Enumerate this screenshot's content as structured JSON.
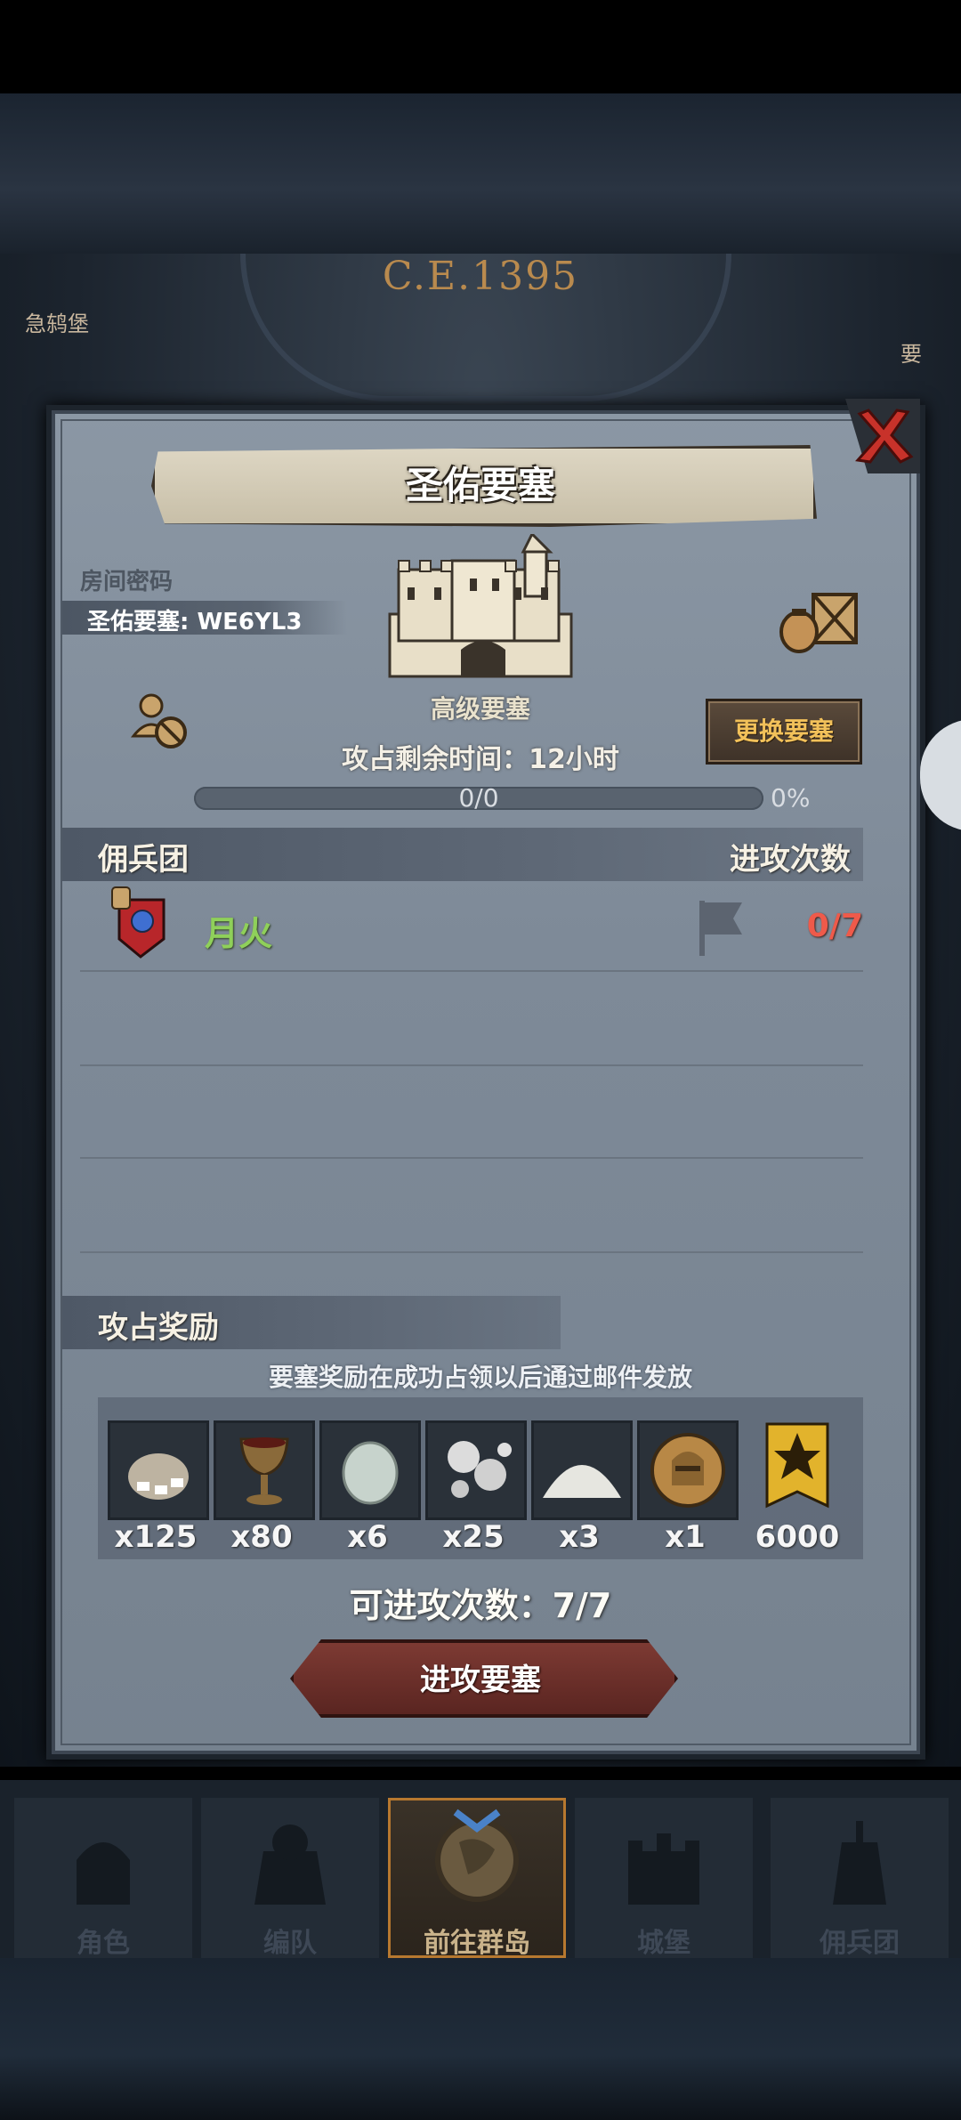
{
  "header": {
    "era": "C.E.1395",
    "side_left": "急鸫堡",
    "side_right": "要"
  },
  "modal": {
    "title": "圣佑要塞",
    "room_label": "房间密码",
    "room_code": "圣佑要塞: WE6YL3",
    "fortress_type": "高级要塞",
    "time_left": "攻占剩余时间：12小时",
    "change_button": "更换要塞",
    "progress": {
      "text": "0/0",
      "percent": "0%",
      "value": 0
    },
    "guild_header": "佣兵团",
    "attacks_header": "进攻次数",
    "guild": {
      "name": "月火",
      "attacks": "0/7"
    },
    "reward_header": "攻占奖励",
    "reward_note": "要塞奖励在成功占领以后通过邮件发放",
    "rewards": [
      {
        "icon": "silver-coins-icon",
        "qty": "x125"
      },
      {
        "icon": "goblet-icon",
        "qty": "x80"
      },
      {
        "icon": "gem-stone-icon",
        "qty": "x6"
      },
      {
        "icon": "pearls-icon",
        "qty": "x25"
      },
      {
        "icon": "powder-icon",
        "qty": "x3"
      },
      {
        "icon": "knight-coin-icon",
        "qty": "x1"
      },
      {
        "icon": "guild-banner-icon",
        "qty": "6000"
      }
    ],
    "available_attacks": "可进攻次数：7/7",
    "attack_button": "进攻要塞"
  },
  "nav": {
    "tabs": [
      {
        "label": "角色",
        "icon": "knight-helmet-icon"
      },
      {
        "label": "编队",
        "icon": "armor-icon"
      },
      {
        "label": "前往群岛",
        "icon": "globe-icon",
        "active": true
      },
      {
        "label": "城堡",
        "icon": "castle-icon"
      },
      {
        "label": "佣兵团",
        "icon": "mercenary-icon"
      }
    ]
  },
  "colors": {
    "accent_gold": "#f2c15a",
    "guild_green": "#8fd05a",
    "count_red": "#ef5a4a"
  }
}
